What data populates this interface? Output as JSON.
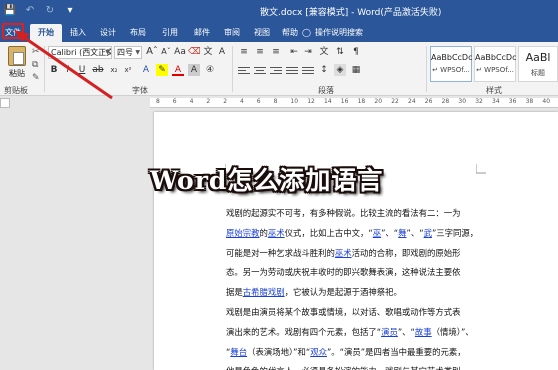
{
  "titlebar": {
    "title": "散文.docx [兼容模式] - Word(产品激活失败)",
    "qat": {
      "save_icon": "save-icon",
      "undo_icon": "undo-icon",
      "redo_icon": "redo-icon"
    }
  },
  "tabs": [
    {
      "label": "文件"
    },
    {
      "label": "开始"
    },
    {
      "label": "插入"
    },
    {
      "label": "设计"
    },
    {
      "label": "布局"
    },
    {
      "label": "引用"
    },
    {
      "label": "邮件"
    },
    {
      "label": "审阅"
    },
    {
      "label": "视图"
    },
    {
      "label": "帮助"
    }
  ],
  "tellme": {
    "icon": "lightbulb-icon",
    "label": "操作说明搜索"
  },
  "ribbon": {
    "clipboard": {
      "paste_label": "粘贴",
      "group_label": "剪贴板"
    },
    "font": {
      "font_name": "Calibri (西文正文",
      "font_size": "四号",
      "group_label": "字体"
    },
    "paragraph": {
      "group_label": "段落"
    },
    "styles": {
      "group_label": "样式",
      "items": [
        {
          "sample": "AaBbCcDc",
          "name": "↵ WPSOf..."
        },
        {
          "sample": "AaBbCcDc",
          "name": "↵ WPSOf..."
        },
        {
          "sample": "AaBl",
          "name": "标题"
        }
      ]
    }
  },
  "ruler": {
    "numbers": [
      "8",
      "6",
      "4",
      "2",
      "2",
      "4",
      "6",
      "8",
      "10",
      "12",
      "14",
      "16",
      "18",
      "20",
      "22",
      "24",
      "26",
      "28",
      "30",
      "32",
      "34",
      "36",
      "38",
      "40"
    ]
  },
  "overlay": {
    "headline": "Word怎么添加语言"
  },
  "document": {
    "lines": [
      [
        {
          "t": "戏剧的起源实不可考，有多种假说。比较主流的看法有二：一为"
        }
      ],
      [
        {
          "t": "原始宗教",
          "link": true
        },
        {
          "t": "的"
        },
        {
          "t": "巫术",
          "link": true
        },
        {
          "t": "仪式，比如上古中文，“"
        },
        {
          "t": "巫",
          "link": true
        },
        {
          "t": "”、“"
        },
        {
          "t": "舞",
          "link": true
        },
        {
          "t": "”、“"
        },
        {
          "t": "武",
          "link": true
        },
        {
          "t": "”三字同源，"
        }
      ],
      [
        {
          "t": "可能是对一种乞求战斗胜利的"
        },
        {
          "t": "巫术",
          "link": true
        },
        {
          "t": "活动的合称，即戏剧的原始形"
        }
      ],
      [
        {
          "t": "态。另一为劳动或庆祝丰收时的即兴歌舞表演，这种说法主要依"
        }
      ],
      [
        {
          "t": "据是"
        },
        {
          "t": "古希腊戏剧",
          "link": true
        },
        {
          "t": "，它被认为是起源于酒神祭祀。"
        }
      ],
      [
        {
          "t": "戏剧是由演员将某个故事或情境，以对话、歌唱或动作等方式表"
        }
      ],
      [
        {
          "t": "演出来的艺术。戏剧有四个元素，包括了“"
        },
        {
          "t": "演员",
          "link": true
        },
        {
          "t": "”、“"
        },
        {
          "t": "故事",
          "link": true
        },
        {
          "t": "（情境）”、"
        }
      ],
      [
        {
          "t": "“"
        },
        {
          "t": "舞台",
          "link": true
        },
        {
          "t": "（表演场地）”和“"
        },
        {
          "t": "观众",
          "link": true
        },
        {
          "t": "”。“演员”是四者当中最重要的元素，"
        }
      ],
      [
        {
          "t": "他是角色的代言人，必须具备扮演的能力。戏剧与其它艺术类别"
        }
      ]
    ]
  }
}
